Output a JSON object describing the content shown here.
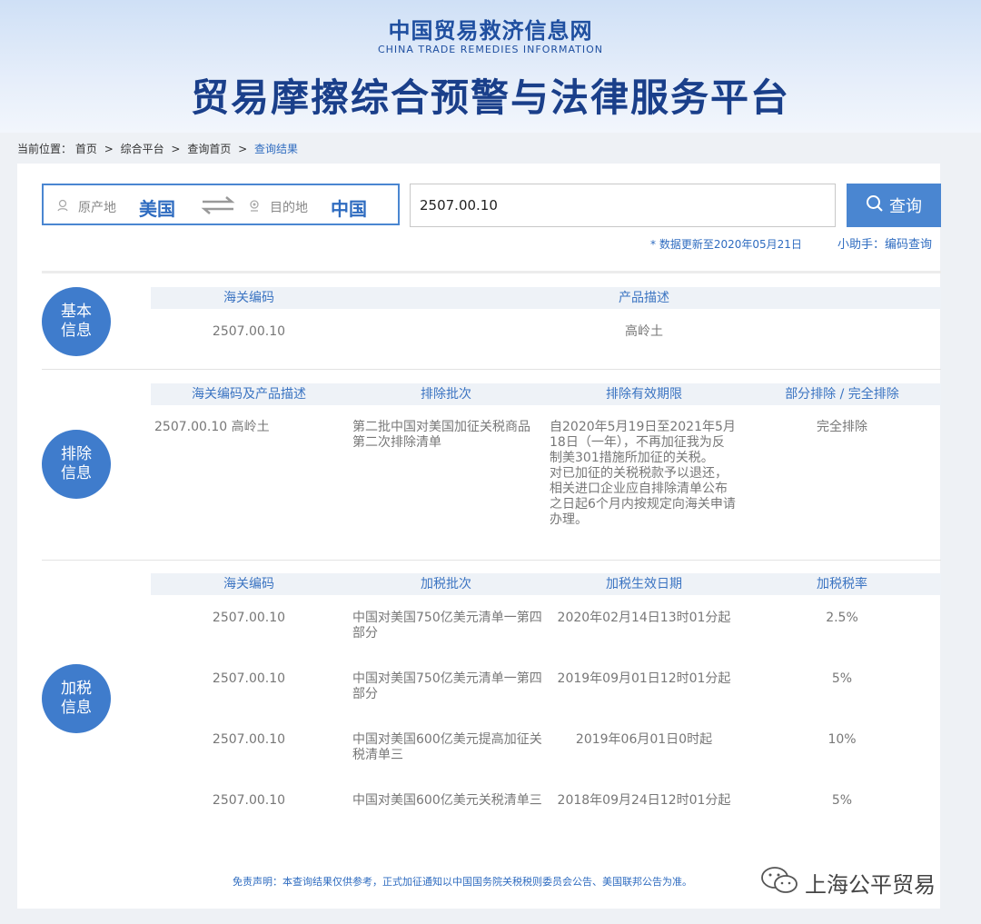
{
  "header": {
    "site_name": "中国贸易救济信息网",
    "site_name_en": "CHINA TRADE REMEDIES INFORMATION",
    "platform_title": "贸易摩擦综合预警与法律服务平台"
  },
  "breadcrumb": {
    "prefix": "当前位置：",
    "items": [
      "首页",
      "综合平台",
      "查询首页",
      "查询结果"
    ],
    "separator": ">"
  },
  "search": {
    "origin_label": "原产地",
    "origin_value": "美国",
    "destination_label": "目的地",
    "destination_value": "中国",
    "query_value": "2507.00.10",
    "button_label": "查询",
    "update_note": "* 数据更新至2020年05月21日",
    "helper_label": "小助手：编码查询"
  },
  "basic": {
    "badge": [
      "基本",
      "信息"
    ],
    "headers": [
      "海关编码",
      "产品描述"
    ],
    "row": [
      "2507.00.10",
      "高岭土"
    ]
  },
  "exclusion": {
    "badge": [
      "排除",
      "信息"
    ],
    "headers": [
      "海关编码及产品描述",
      "排除批次",
      "排除有效期限",
      "部分排除 / 完全排除"
    ],
    "row": {
      "code_desc": "2507.00.10 高岭土",
      "batch": [
        "第二批中国对美国加征关税商品",
        "第二次排除清单"
      ],
      "validity": [
        "自2020年5月19日至2021年5月",
        "18日（一年），不再加征我为反",
        "制美301措施所加征的关税。",
        "对已加征的关税税款予以退还，",
        "相关进口企业应自排除清单公布",
        "之日起6个月内按规定向海关申请",
        "办理。"
      ],
      "type": "完全排除"
    }
  },
  "tariff": {
    "badge": [
      "加税",
      "信息"
    ],
    "headers": [
      "海关编码",
      "加税批次",
      "加税生效日期",
      "加税税率"
    ],
    "rows": [
      {
        "code": "2507.00.10",
        "batch": [
          "中国对美国750亿美元清单一第四",
          "部分"
        ],
        "date": "2020年02月14日13时01分起",
        "rate": "2.5%"
      },
      {
        "code": "2507.00.10",
        "batch": [
          "中国对美国750亿美元清单一第四",
          "部分"
        ],
        "date": "2019年09月01日12时01分起",
        "rate": "5%"
      },
      {
        "code": "2507.00.10",
        "batch": [
          "中国对美国600亿美元提高加征关",
          "税清单三"
        ],
        "date": "2019年06月01日0时起",
        "rate": "10%"
      },
      {
        "code": "2507.00.10",
        "batch": [
          "中国对美国600亿美元关税清单三",
          ""
        ],
        "date": "2018年09月24日12时01分起",
        "rate": "5%"
      }
    ]
  },
  "footer": {
    "disclaimer": "免责声明：本查询结果仅供参考，正式加征通知以中国国务院关税税则委员会公告、美国联邦公告为准。",
    "watermark": "上海公平贸易"
  },
  "colors": {
    "accent": "#3f7ccc",
    "brand": "#1f4fa0",
    "link": "#2f6cc0"
  },
  "icons": [
    "location-icon",
    "target-icon",
    "swap-arrows-icon",
    "search-icon",
    "wechat-icon"
  ]
}
